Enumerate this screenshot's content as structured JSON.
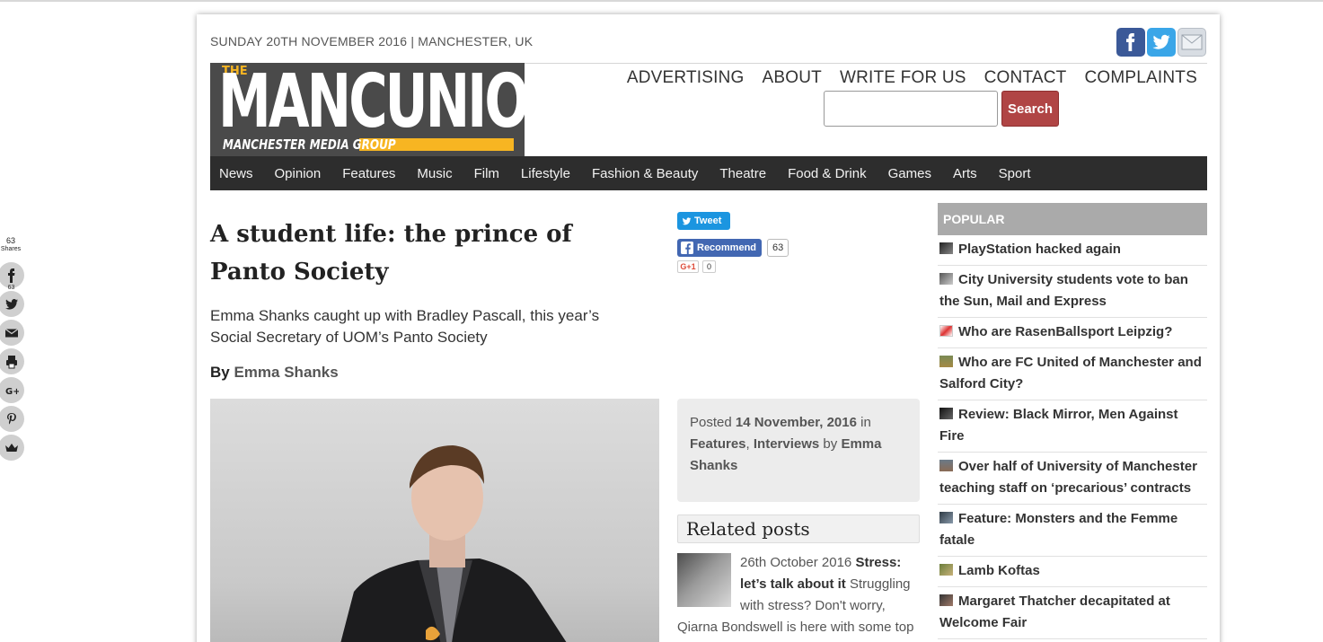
{
  "dateline": "SUNDAY 20TH NOVEMBER 2016 | MANCHESTER, UK",
  "logo": {
    "the": "THE",
    "name": "MANCUNION",
    "tagline": "MANCHESTER MEDIA GROUP"
  },
  "header_links": [
    "ADVERTISING",
    "ABOUT",
    "WRITE FOR US",
    "CONTACT",
    "COMPLAINTS"
  ],
  "search": {
    "placeholder": "",
    "button": "Search"
  },
  "nav": [
    "News",
    "Opinion",
    "Features",
    "Music",
    "Film",
    "Lifestyle",
    "Fashion & Beauty",
    "Theatre",
    "Food & Drink",
    "Games",
    "Arts",
    "Sport"
  ],
  "share_sidebar": {
    "count": "63",
    "count_label": "Shares",
    "facebook_count": "63"
  },
  "article": {
    "title": "A student life: the prince of Panto Society",
    "standfirst": "Emma Shanks caught up with Bradley Pascall, this year’s Social Secretary of UOM’s Panto Society",
    "byline_prefix": "By ",
    "author": "Emma Shanks"
  },
  "social_buttons": {
    "tweet": "Tweet",
    "recommend": "Recommend",
    "recommend_count": "63",
    "gplus": "G+1",
    "gplus_count": "0"
  },
  "post_info": {
    "posted": "Posted ",
    "date": "14 November, 2016",
    "in": " in ",
    "cat1": "Features",
    "sep": ", ",
    "cat2": "Interviews",
    "by": " by ",
    "author": "Emma Shanks"
  },
  "related": {
    "heading": "Related posts",
    "item_date": "26th October 2016 ",
    "item_title": "Stress: let’s talk about it",
    "item_text": " Struggling with stress? Don't worry, Qiarna Bondswell is here with some top"
  },
  "popular": {
    "heading": "POPULAR",
    "items": [
      "PlayStation hacked again",
      "City University students vote to ban the Sun, Mail and Express",
      "Who are RasenBallsport Leipzig?",
      "Who are FC United of Manchester and Salford City?",
      "Review: Black Mirror, Men Against Fire",
      "Over half of University of Manchester teaching staff on ‘precarious’ contracts",
      "Feature: Monsters and the Femme fatale",
      "Lamb Koftas",
      "Margaret Thatcher decapitated at Welcome Fair"
    ]
  },
  "colors": {
    "nav_bg": "#2d2d2d",
    "search_button": "#b04545",
    "logo_bg": "#4a4a4a",
    "logo_accent": "#f7b522",
    "popular_head": "#aaaaaa",
    "post_info_bg": "#ececec"
  },
  "icons": [
    "facebook-icon",
    "twitter-icon",
    "mail-icon",
    "print-icon",
    "google-plus-icon",
    "pinterest-icon",
    "crown-icon"
  ]
}
